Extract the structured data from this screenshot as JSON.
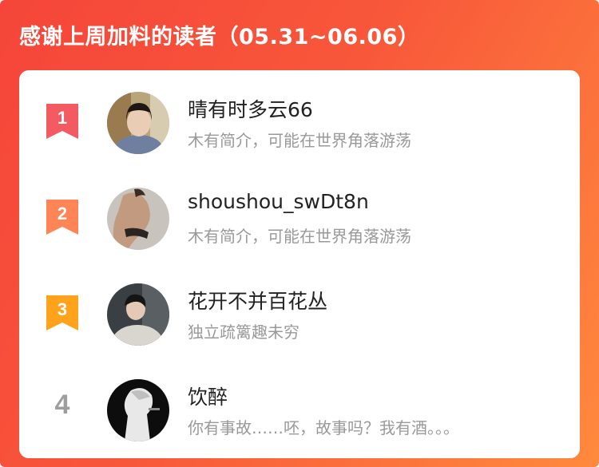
{
  "header": {
    "title": "感谢上周加料的读者（05.31~06.06）"
  },
  "colors": {
    "rank1": "#f45a62",
    "rank2": "#ff8557",
    "rank3": "#ffa21c",
    "rank_plain": "#9e9e9e",
    "name_text": "#222222",
    "bio_text": "#999999"
  },
  "readers": [
    {
      "rank": "1",
      "name": "晴有时多云66",
      "bio": "木有简介，可能在世界角落游荡"
    },
    {
      "rank": "2",
      "name": "shoushou_swDt8n",
      "bio": "木有简介，可能在世界角落游荡"
    },
    {
      "rank": "3",
      "name": "花开不并百花丛",
      "bio": "独立疏篱趣未穷"
    },
    {
      "rank": "4",
      "name": "饮醉",
      "bio": "你有事故……呸，故事吗？我有酒。。。"
    }
  ]
}
